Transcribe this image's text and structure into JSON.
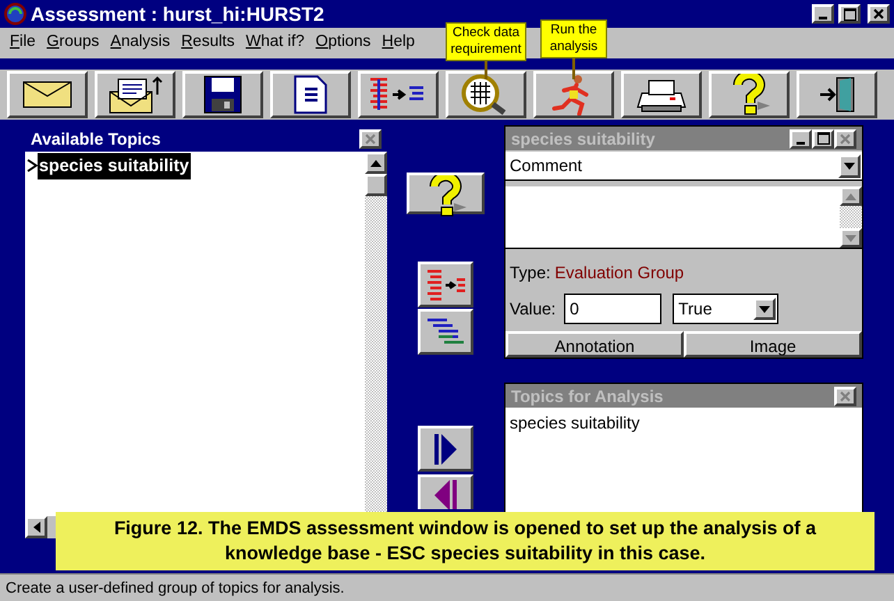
{
  "window": {
    "title": "Assessment : hurst_hi:HURST2"
  },
  "menu": [
    {
      "label": "File"
    },
    {
      "label": "Groups"
    },
    {
      "label": "Analysis"
    },
    {
      "label": "Results"
    },
    {
      "label": "What if?"
    },
    {
      "label": "Options"
    },
    {
      "label": "Help"
    }
  ],
  "toolbar": [
    {
      "kind": "envelope"
    },
    {
      "kind": "mail-send"
    },
    {
      "kind": "floppy"
    },
    {
      "kind": "document"
    },
    {
      "kind": "move-lines"
    },
    {
      "kind": "magnifier"
    },
    {
      "kind": "runner"
    },
    {
      "kind": "printer"
    },
    {
      "kind": "question"
    },
    {
      "kind": "exit"
    }
  ],
  "tooltips": [
    {
      "text": "Check data requirement"
    },
    {
      "text": "Run the analysis"
    }
  ],
  "available_topics": {
    "title": "Available Topics",
    "items": [
      {
        "label": "species suitability",
        "selected": true
      }
    ]
  },
  "detail": {
    "title": "species suitability",
    "active": false,
    "section": "Comment",
    "type_label": "Type:",
    "type_value": "Evaluation Group",
    "value_label": "Value:",
    "value": "0",
    "choice": "True",
    "buttons": [
      "Annotation",
      "Image"
    ]
  },
  "topics_for_analysis": {
    "title": "Topics for Analysis",
    "items": [
      "species suitability"
    ]
  },
  "caption": [
    "Figure 12. The EMDS assessment window is opened to set up the analysis of a",
    "knowledge base - ESC species suitability in this case."
  ],
  "status_bar": "Create a user-defined group of topics for analysis."
}
